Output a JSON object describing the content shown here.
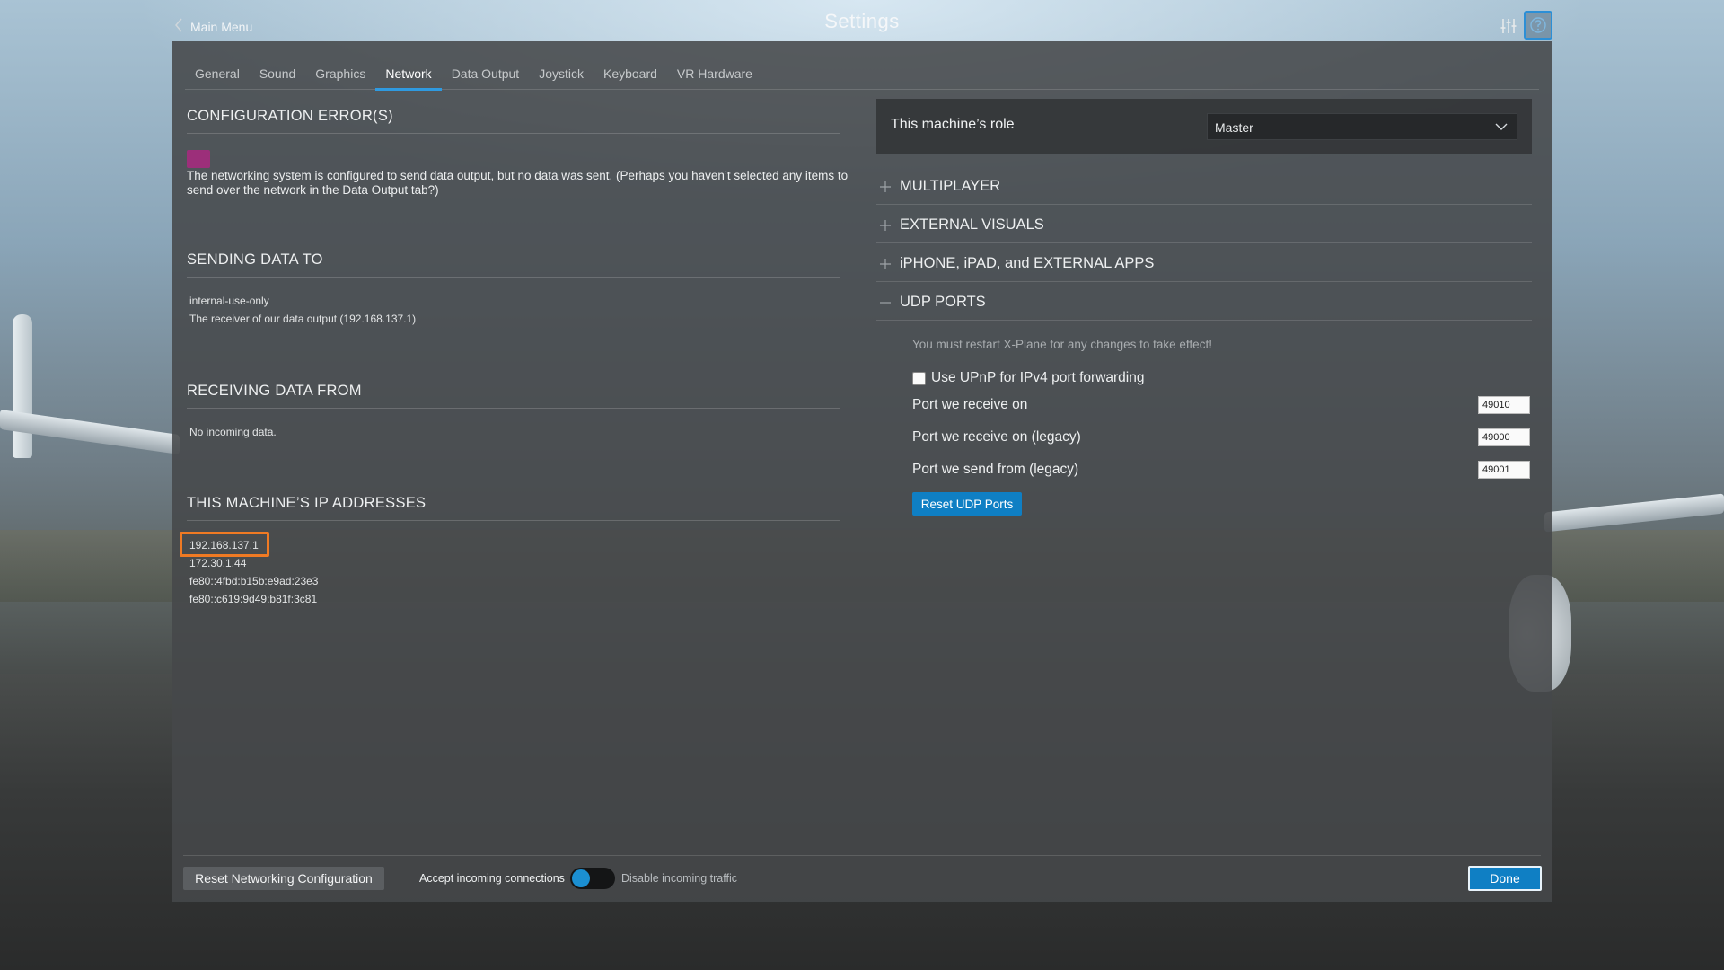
{
  "topbar": {
    "back_label": "Main Menu",
    "title": "Settings"
  },
  "tabs": [
    {
      "label": "General"
    },
    {
      "label": "Sound"
    },
    {
      "label": "Graphics"
    },
    {
      "label": "Network",
      "active": true
    },
    {
      "label": "Data Output"
    },
    {
      "label": "Joystick"
    },
    {
      "label": "Keyboard"
    },
    {
      "label": "VR Hardware"
    }
  ],
  "left": {
    "config_errors": {
      "title": "CONFIGURATION ERROR(S)",
      "swatch_color": "#9c2f7a",
      "message": "The networking system is configured to send data output, but no data was sent. (Perhaps you haven’t selected any items to send over the network in the Data Output tab?)"
    },
    "sending": {
      "title": "SENDING DATA TO",
      "lines": [
        "internal-use-only",
        "The receiver of our data output (192.168.137.1)"
      ]
    },
    "receiving": {
      "title": "RECEIVING DATA FROM",
      "lines": [
        "No incoming data."
      ]
    },
    "ips": {
      "title": "THIS MACHINE’S IP ADDRESSES",
      "addresses": [
        "192.168.137.1",
        "172.30.1.44",
        "fe80::4fbd:b15b:e9ad:23e3",
        "fe80::c619:9d49:b81f:3c81"
      ],
      "highlight_color": "#f07a23"
    }
  },
  "right": {
    "role": {
      "label": "This machine’s role",
      "value": "Master"
    },
    "accordions": [
      {
        "label": "MULTIPLAYER",
        "expanded": false
      },
      {
        "label": "EXTERNAL VISUALS",
        "expanded": false
      },
      {
        "label": "iPHONE, iPAD, and EXTERNAL APPS",
        "expanded": false
      },
      {
        "label": "UDP PORTS",
        "expanded": true
      }
    ],
    "udp": {
      "note": "You must restart X-Plane for any changes to take effect!",
      "upnp_label": "Use UPnP for IPv4 port forwarding",
      "upnp_checked": false,
      "ports": [
        {
          "label": "Port we receive on",
          "value": "49010"
        },
        {
          "label": "Port we receive on (legacy)",
          "value": "49000"
        },
        {
          "label": "Port we send from (legacy)",
          "value": "49001"
        }
      ],
      "reset_label": "Reset UDP Ports"
    }
  },
  "footer": {
    "reset_label": "Reset Networking Configuration",
    "accept_label": "Accept incoming connections",
    "disable_label": "Disable incoming traffic",
    "done_label": "Done"
  },
  "colors": {
    "accent": "#0f7fc4",
    "tab_underline": "#2f9ae0"
  }
}
